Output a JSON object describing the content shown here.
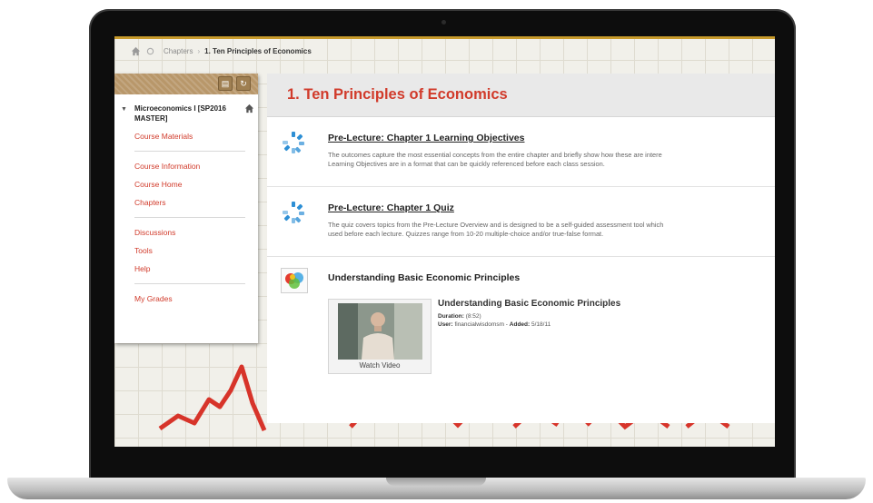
{
  "breadcrumb": {
    "parent": "Chapters",
    "separator": "›",
    "current": "1. Ten Principles of Economics"
  },
  "sidebar": {
    "course_title": "Microeconomics I [SP2016 MASTER]",
    "groups": [
      [
        "Course Materials"
      ],
      [
        "Course Information",
        "Course Home",
        "Chapters"
      ],
      [
        "Discussions",
        "Tools",
        "Help"
      ],
      [
        "My Grades"
      ]
    ]
  },
  "main": {
    "title": "1. Ten Principles of Economics",
    "items": [
      {
        "title": "Pre-Lecture: Chapter 1 Learning Objectives",
        "desc_line1": "The outcomes capture the most essential concepts from the entire chapter and briefly show how these are intere",
        "desc_line2": "Learning Objectives are in a format that can be quickly referenced before each class session."
      },
      {
        "title": "Pre-Lecture: Chapter 1 Quiz",
        "desc_line1": "The quiz covers topics from the Pre-Lecture Overview and is designed to be a self-guided assessment tool which",
        "desc_line2": "used before each lecture. Quizzes range from 10-20 multiple-choice and/or true-false format."
      },
      {
        "title": "Understanding Basic Economic Principles",
        "video": {
          "watch_label": "Watch Video",
          "title": "Understanding Basic Economic Principles",
          "duration_label": "Duration:",
          "duration": "(8:52)",
          "user_label": "User:",
          "user": "financialwisdomsm",
          "added_label": "Added:",
          "added": "5/18/11"
        }
      }
    ]
  },
  "colors": {
    "accent_red": "#d13b2b",
    "gold": "#c79a2b",
    "sidebar_header": "#b8976a",
    "icon_blue": "#2d8fd5"
  },
  "icons": [
    "home-icon",
    "reload-icon",
    "folder-icon",
    "refresh-icon",
    "course-home-icon",
    "spinner-icon",
    "media-icon"
  ]
}
